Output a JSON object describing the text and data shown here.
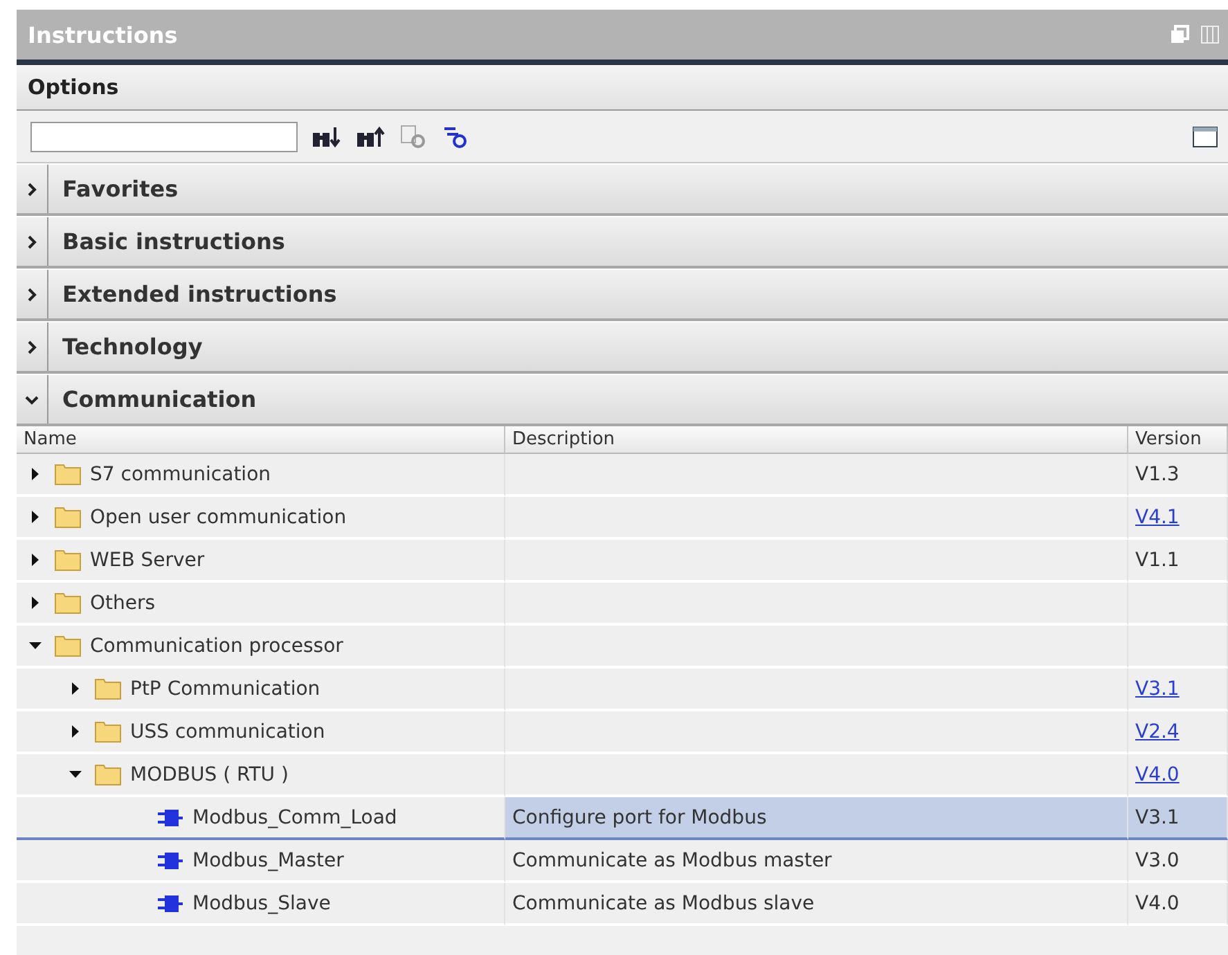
{
  "panel": {
    "title": "Instructions"
  },
  "options": {
    "title": "Options"
  },
  "sections": [
    {
      "label": "Favorites",
      "expanded": false
    },
    {
      "label": "Basic instructions",
      "expanded": false
    },
    {
      "label": "Extended instructions",
      "expanded": false
    },
    {
      "label": "Technology",
      "expanded": false
    },
    {
      "label": "Communication",
      "expanded": true
    }
  ],
  "table": {
    "columns": [
      "Name",
      "Description",
      "Version"
    ],
    "rows": [
      {
        "kind": "folder",
        "name": "S7 communication",
        "expanded": false,
        "selected": false,
        "version": "V1.3",
        "version_link": false
      },
      {
        "kind": "folder",
        "name": "Open user communication",
        "expanded": false,
        "selected": false,
        "version": "V4.1",
        "version_link": true
      },
      {
        "kind": "folder",
        "name": "WEB Server",
        "expanded": false,
        "selected": false,
        "version": "V1.1",
        "version_link": false
      },
      {
        "kind": "folder",
        "name": "Others",
        "expanded": false,
        "selected": false
      },
      {
        "kind": "folder",
        "name": "Communication processor",
        "expanded": true,
        "selected": false,
        "children": [
          {
            "kind": "folder",
            "name": "PtP Communication",
            "expanded": false,
            "selected": false,
            "version": "V3.1",
            "version_link": true
          },
          {
            "kind": "folder",
            "name": "USS communication",
            "expanded": false,
            "selected": false,
            "version": "V2.4",
            "version_link": true
          },
          {
            "kind": "folder",
            "name": "MODBUS ( RTU )",
            "expanded": true,
            "selected": false,
            "version": "V4.0",
            "version_link": true,
            "children": [
              {
                "kind": "block",
                "name": "Modbus_Comm_Load",
                "selected": true,
                "description": "Configure port for Modbus",
                "version": "V3.1",
                "version_link": false
              },
              {
                "kind": "block",
                "name": "Modbus_Master",
                "selected": false,
                "description": "Communicate as Modbus master",
                "version": "V3.0",
                "version_link": false
              },
              {
                "kind": "block",
                "name": "Modbus_Slave",
                "selected": false,
                "description": "Communicate as Modbus slave",
                "version": "V4.0",
                "version_link": false
              }
            ]
          }
        ]
      }
    ]
  }
}
